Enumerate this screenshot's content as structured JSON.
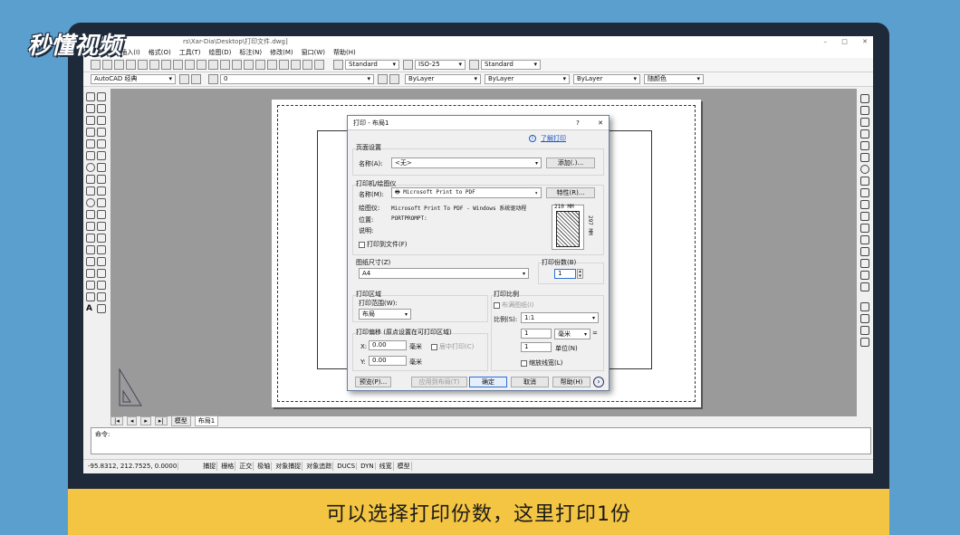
{
  "logo": "秒懂视频",
  "subtitle": "可以选择打印份数，这里打印1份",
  "window": {
    "title": "rs\\Xar-Dia\\Desktop\\打印文件.dwg]"
  },
  "menu": [
    "视图(V)",
    "插入(I)",
    "格式(O)",
    "工具(T)",
    "绘图(D)",
    "标注(N)",
    "修改(M)",
    "窗口(W)",
    "帮助(H)"
  ],
  "toolbar": {
    "text_style": "Standard",
    "dim_style": "ISO-25",
    "table_style": "Standard",
    "workspace": "AutoCAD 经典",
    "layer": "0",
    "color": "ByLayer",
    "linetype": "ByLayer",
    "lineweight": "ByLayer",
    "plotstyle": "随颜色"
  },
  "tabs": [
    "模型",
    "布局1"
  ],
  "command": {
    "prompt": "命令:"
  },
  "status": {
    "coords": "-95.8312, 212.7525, 0.0000",
    "toggles": [
      "捕捉",
      "栅格",
      "正交",
      "极轴",
      "对象捕捉",
      "对象追踪",
      "DUCS",
      "DYN",
      "线宽",
      "模型"
    ]
  },
  "dialog": {
    "title": "打印 - 布局1",
    "help_q": "?",
    "close": "✕",
    "info_icon": "i",
    "learn_link": "了解打印",
    "page_setup": {
      "label": "页面设置",
      "name_label": "名称(A):",
      "name_value": "<无>",
      "add_button": "添加(.)..."
    },
    "printer": {
      "label": "打印机/绘图仪",
      "name_label": "名称(M):",
      "name_value": "Microsoft Print to PDF",
      "properties_button": "特性(R)...",
      "plotter_label": "绘图仪:",
      "plotter_value": "Microsoft Print To PDF - Windows 系统驱动程",
      "location_label": "位置:",
      "location_value": "PORTPROMPT:",
      "desc_label": "说明:",
      "print_to_file": "打印到文件(F)",
      "preview_w": "210 MM",
      "preview_h": "297 MM"
    },
    "paper": {
      "label": "图纸尺寸(Z)",
      "value": "A4"
    },
    "copies": {
      "label": "打印份数(B)",
      "value": "1"
    },
    "area": {
      "label": "打印区域",
      "range_label": "打印范围(W):",
      "range_value": "布局"
    },
    "offset": {
      "label": "打印偏移 (原点设置在可打印区域)",
      "x_label": "X:",
      "x_value": "0.00",
      "y_label": "Y:",
      "y_value": "0.00",
      "unit": "毫米",
      "center": "居中打印(C)"
    },
    "scale": {
      "label": "打印比例",
      "fit": "布满图纸(I)",
      "scale_label": "比例(S):",
      "scale_value": "1:1",
      "num": "1",
      "num_unit": "毫米",
      "eq": "=",
      "den": "1",
      "den_unit": "单位(N)",
      "lineweights": "缩放线宽(L)"
    },
    "buttons": {
      "preview": "预览(P)...",
      "apply": "应用到布局(T)",
      "ok": "确定",
      "cancel": "取消",
      "help": "帮助(H)",
      "expand": "›"
    }
  }
}
